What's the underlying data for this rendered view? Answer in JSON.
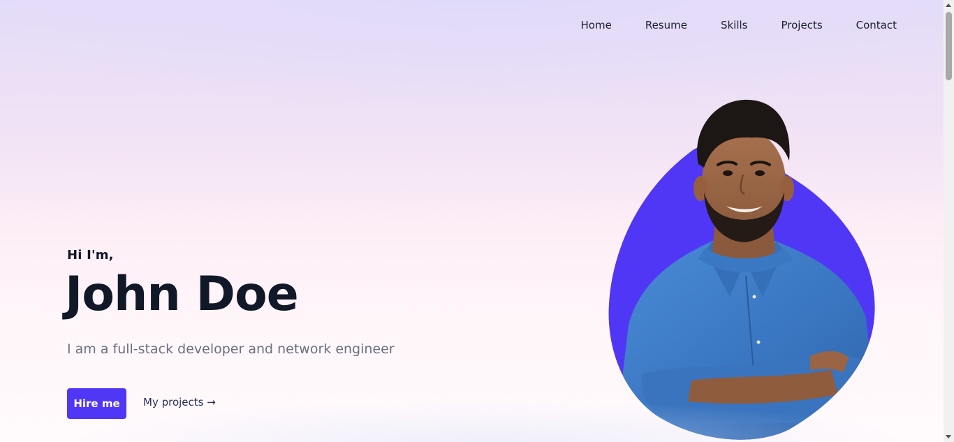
{
  "nav": {
    "items": [
      {
        "label": "Home"
      },
      {
        "label": "Resume"
      },
      {
        "label": "Skills"
      },
      {
        "label": "Projects"
      },
      {
        "label": "Contact"
      }
    ]
  },
  "hero": {
    "greeting": "Hi I'm,",
    "name": "John Doe",
    "subtitle": "I am a full-stack developer and network engineer",
    "cta_primary": "Hire me",
    "cta_secondary": "My projects →"
  },
  "portrait": {
    "blob_color": "#5037f5",
    "shirt_color": "#3f7ec9"
  },
  "colors": {
    "accent": "#5037f5",
    "heading": "#111827",
    "muted_text": "#6b6f80"
  }
}
